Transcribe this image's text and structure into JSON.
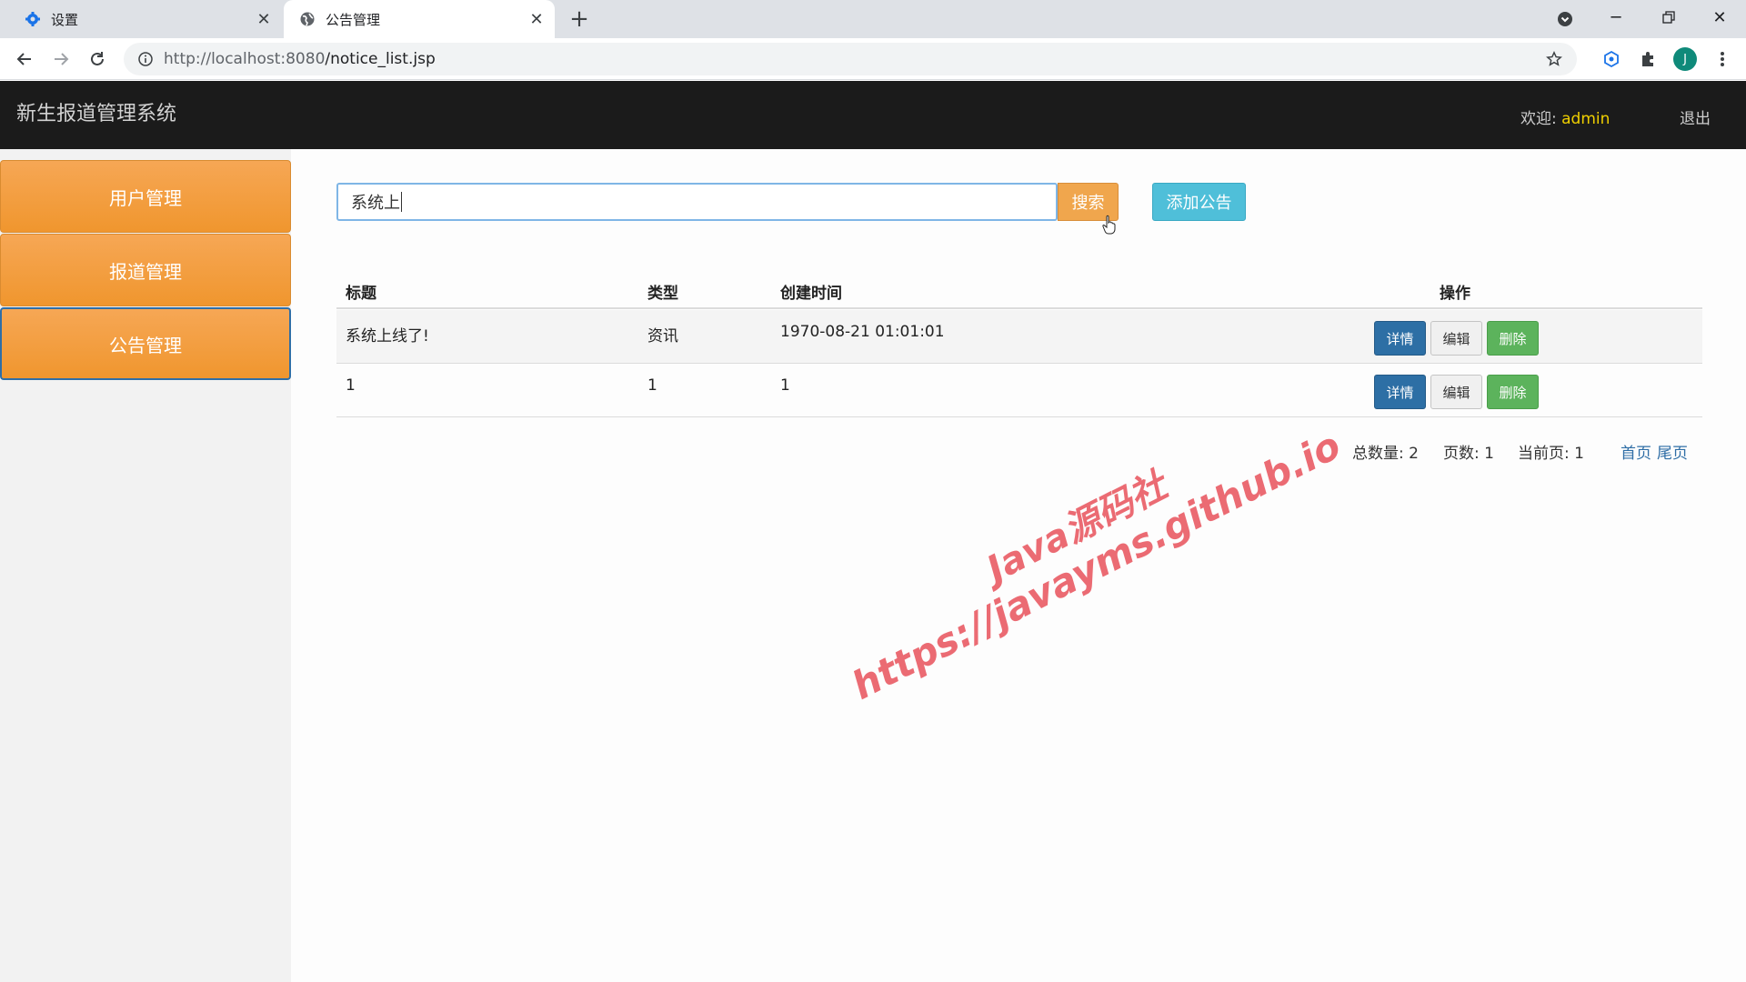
{
  "browser": {
    "tabs": [
      {
        "title": "设置",
        "icon": "gear-icon",
        "active": false
      },
      {
        "title": "公告管理",
        "icon": "globe-icon",
        "active": true
      }
    ],
    "url_host": "http://localhost:8080",
    "url_path": "/notice_list.jsp",
    "profile_initial": "J"
  },
  "header": {
    "title": "新生报道管理系统",
    "welcome_label": "欢迎:",
    "username": "admin",
    "logout_label": "退出"
  },
  "sidebar": {
    "items": [
      {
        "label": "用户管理"
      },
      {
        "label": "报道管理"
      },
      {
        "label": "公告管理",
        "active": true
      }
    ]
  },
  "search": {
    "value": "系统上",
    "button_label": "搜索",
    "add_label": "添加公告"
  },
  "table": {
    "headers": [
      "标题",
      "类型",
      "创建时间",
      "操作"
    ],
    "rows": [
      {
        "title": "系统上线了!",
        "type": "资讯",
        "created": "1970-08-21 01:01:01"
      },
      {
        "title": "1",
        "type": "1",
        "created": "1"
      }
    ],
    "actions": {
      "detail": "详情",
      "edit": "编辑",
      "delete": "删除"
    }
  },
  "pagination": {
    "total_label": "总数量:",
    "total": "2",
    "pages_label": "页数:",
    "pages": "1",
    "current_label": "当前页:",
    "current": "1",
    "first_label": "首页",
    "last_label": "尾页"
  },
  "watermark": {
    "line1": "Java源码社",
    "line2": "https://javayms.github.io"
  },
  "colors": {
    "header_bg": "#1b1b1b",
    "sidebar_orange": "#f0962e",
    "username": "#f0d000",
    "detail_btn": "#2d6fa5",
    "delete_btn": "#5cb35c",
    "add_btn": "#4fbfd9",
    "watermark": "#e64650"
  }
}
